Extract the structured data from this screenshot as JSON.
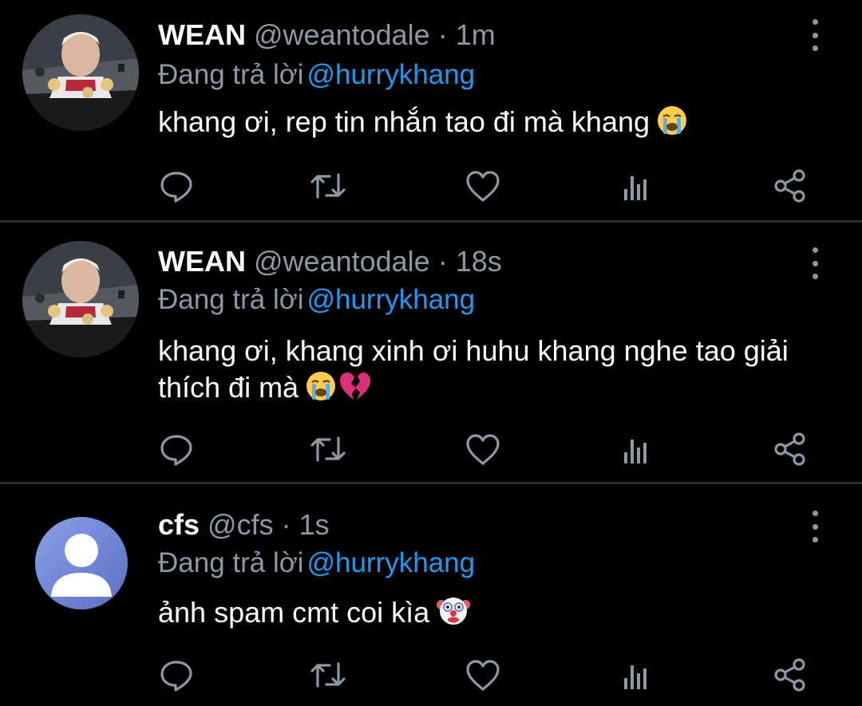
{
  "tweets": [
    {
      "name": "WEAN",
      "handle": "@weantodale",
      "separator": "·",
      "time": "1m",
      "replying_prefix": "Đang trả lời",
      "replying_to": "@hurrykhang",
      "text": "khang ơi, rep tin nhắn tao đi mà khang",
      "emojis": [
        "loudly-crying-face"
      ]
    },
    {
      "name": "WEAN",
      "handle": "@weantodale",
      "separator": "·",
      "time": "18s",
      "replying_prefix": "Đang trả lời",
      "replying_to": "@hurrykhang",
      "text": "khang ơi, khang xinh ơi huhu khang nghe tao giải thích đi mà",
      "emojis": [
        "loudly-crying-face",
        "broken-heart"
      ]
    },
    {
      "name": "cfs",
      "handle": "@cfs",
      "separator": "·",
      "time": "1s",
      "replying_prefix": "Đang trả lời",
      "replying_to": "@hurrykhang",
      "text": "ảnh spam cmt coi kìa",
      "emojis": [
        "clown-face"
      ]
    }
  ],
  "actions": [
    "reply-icon",
    "retweet-icon",
    "like-icon",
    "analytics-icon",
    "share-icon"
  ],
  "colors": {
    "background": "#000000",
    "text": "#ffffff",
    "muted": "#8b98a5",
    "mention": "#1d9bf0",
    "divider": "#2a2d31",
    "default_avatar_bg": "#6f84cf"
  }
}
